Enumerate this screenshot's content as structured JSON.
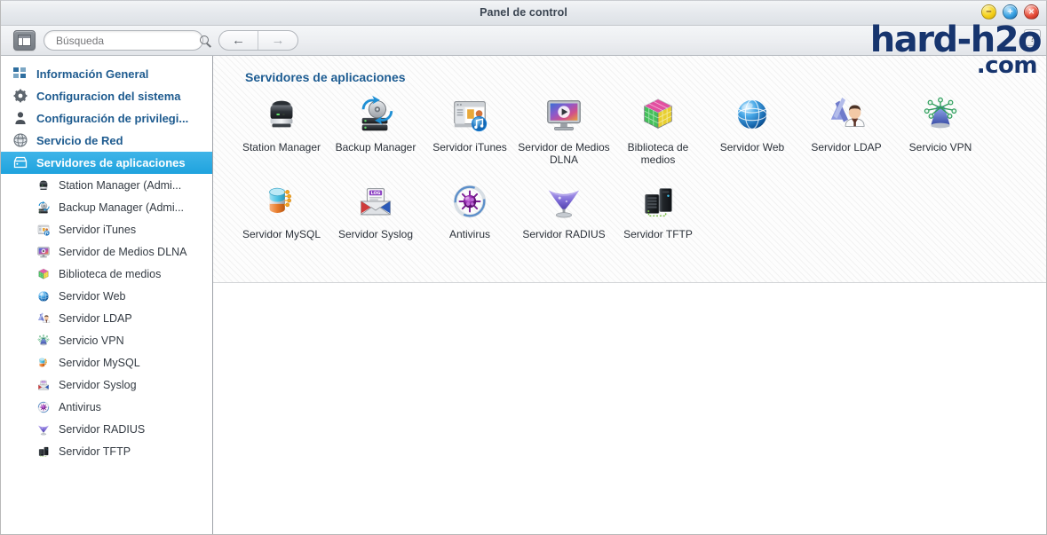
{
  "window": {
    "title": "Panel de control",
    "controls": [
      {
        "name": "minimize-button",
        "glyph": "−",
        "color": "#f4d019"
      },
      {
        "name": "maximize-button",
        "glyph": "+",
        "color": "#3ba3e3"
      },
      {
        "name": "close-button",
        "glyph": "×",
        "color": "#e8503c"
      }
    ]
  },
  "toolbar": {
    "panel_toggle_icon": "panel-layout-icon",
    "search": {
      "value": "",
      "placeholder": "Búsqueda",
      "icon": "search-icon"
    },
    "back_glyph": "←",
    "forward_glyph": "→",
    "back_label": "Atrás",
    "forward_label": "Adelante"
  },
  "help_button": {
    "label": "?"
  },
  "logo": {
    "line1": "hard-h2o",
    "line2": ".com",
    "color": "#17356e"
  },
  "sidebar": {
    "selected_color": "#1fa3de",
    "items": [
      {
        "label": "Información General",
        "icon": "grid-squares-icon",
        "selected": false
      },
      {
        "label": "Configuracion del sistema",
        "icon": "gear-icon",
        "selected": false
      },
      {
        "label": "Configuración de privilegi...",
        "icon": "user-icon",
        "selected": false
      },
      {
        "label": "Servicio de Red",
        "icon": "globe-network-icon",
        "selected": false
      },
      {
        "label": "Servidores de aplicaciones",
        "icon": "server-box-icon",
        "selected": true
      }
    ],
    "sub_items": [
      {
        "label": "Station Manager (Admi...",
        "icon": "station-manager-icon"
      },
      {
        "label": "Backup Manager (Admi...",
        "icon": "backup-manager-icon"
      },
      {
        "label": "Servidor iTunes",
        "icon": "itunes-server-icon"
      },
      {
        "label": "Servidor de Medios DLNA",
        "icon": "dlna-media-server-icon"
      },
      {
        "label": "Biblioteca de medios",
        "icon": "media-library-icon"
      },
      {
        "label": "Servidor Web",
        "icon": "web-server-icon"
      },
      {
        "label": "Servidor LDAP",
        "icon": "ldap-server-icon"
      },
      {
        "label": "Servicio VPN",
        "icon": "vpn-service-icon"
      },
      {
        "label": "Servidor MySQL",
        "icon": "mysql-server-icon"
      },
      {
        "label": "Servidor Syslog",
        "icon": "syslog-server-icon"
      },
      {
        "label": "Antivirus",
        "icon": "antivirus-icon"
      },
      {
        "label": "Servidor RADIUS",
        "icon": "radius-server-icon"
      },
      {
        "label": "Servidor TFTP",
        "icon": "tftp-server-icon"
      }
    ]
  },
  "main": {
    "section_title": "Servidores de aplicaciones",
    "tiles": [
      {
        "label": "Station Manager",
        "icon": "station-manager-icon"
      },
      {
        "label": "Backup Manager",
        "icon": "backup-manager-icon"
      },
      {
        "label": "Servidor iTunes",
        "icon": "itunes-server-icon"
      },
      {
        "label": "Servidor de Medios DLNA",
        "icon": "dlna-media-server-icon"
      },
      {
        "label": "Biblioteca de medios",
        "icon": "media-library-icon"
      },
      {
        "label": "Servidor Web",
        "icon": "web-server-icon"
      },
      {
        "label": "Servidor LDAP",
        "icon": "ldap-server-icon"
      },
      {
        "label": "Servicio VPN",
        "icon": "vpn-service-icon"
      },
      {
        "label": "Servidor MySQL",
        "icon": "mysql-server-icon"
      },
      {
        "label": "Servidor Syslog",
        "icon": "syslog-server-icon"
      },
      {
        "label": "Antivirus",
        "icon": "antivirus-icon"
      },
      {
        "label": "Servidor RADIUS",
        "icon": "radius-server-icon"
      },
      {
        "label": "Servidor TFTP",
        "icon": "tftp-server-icon"
      }
    ]
  }
}
